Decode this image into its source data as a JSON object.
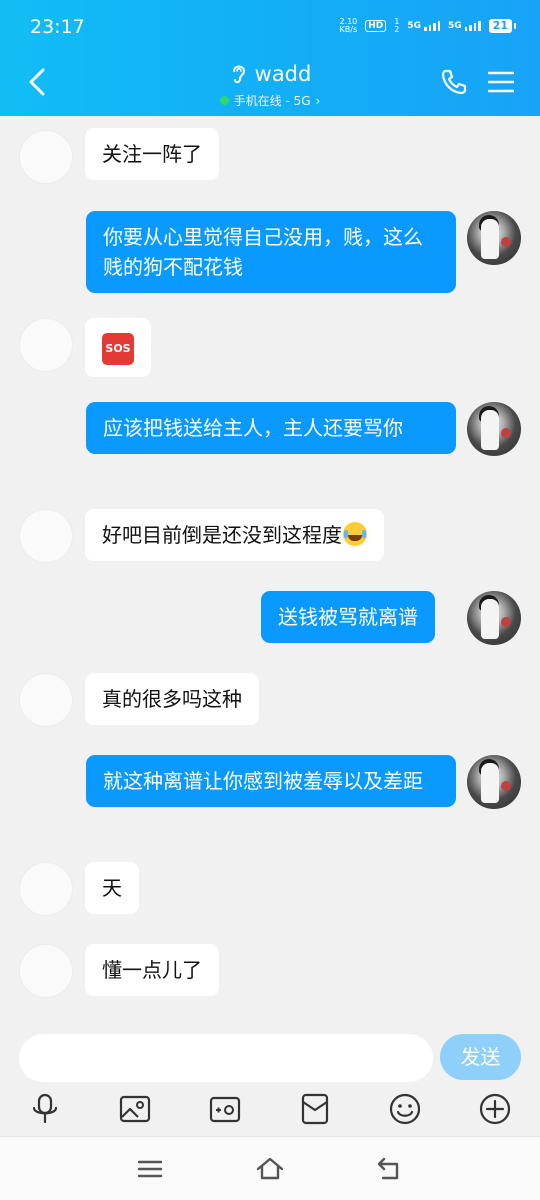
{
  "status_bar": {
    "time": "23:17",
    "net_speed_value": "2.10",
    "net_speed_unit": "KB/s",
    "hd_label": "HD",
    "sim1": "1",
    "sim2": "2",
    "sig1_label": "5G",
    "sig2_label": "5G",
    "battery": "21"
  },
  "header": {
    "contact_name": "wadd",
    "online_status": "手机在线 - 5G",
    "online_chevron": "›"
  },
  "messages": [
    {
      "side": "left",
      "text": "关注一阵了"
    },
    {
      "side": "right",
      "text": "你要从心里觉得自己没用，贱，这么贱的狗不配花钱"
    },
    {
      "side": "left",
      "text": "SOS",
      "emoji": "sos"
    },
    {
      "side": "right",
      "text": "应该把钱送给主人，主人还要骂你"
    },
    {
      "side": "left",
      "text": "好吧目前倒是还没到这程度",
      "emoji": "face-with-tears-of-joy"
    },
    {
      "side": "right",
      "text": "送钱被骂就离谱"
    },
    {
      "side": "left",
      "text": "真的很多吗这种"
    },
    {
      "side": "right",
      "text": "就这种离谱让你感到被羞辱以及差距"
    },
    {
      "side": "left",
      "text": "天"
    },
    {
      "side": "left",
      "text": "懂一点儿了"
    }
  ],
  "input": {
    "value": "",
    "placeholder": "",
    "send_label": "发送"
  },
  "toolbar": [
    "microphone-icon",
    "image-icon",
    "camera-icon",
    "red-envelope-icon",
    "emoji-icon",
    "plus-icon"
  ],
  "nav": [
    "menu-icon",
    "home-icon",
    "back-icon"
  ],
  "colors": {
    "header": "#12aff6",
    "bubble_sent": "#0a99ff",
    "bubble_received": "#ffffff",
    "send_button": "#8fd0fb",
    "online_dot": "#2fd86a"
  }
}
